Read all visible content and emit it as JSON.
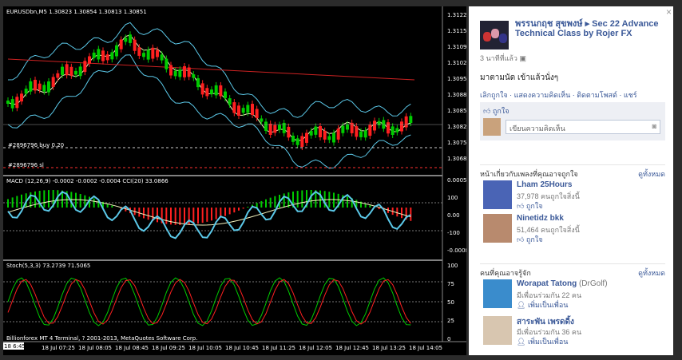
{
  "chart": {
    "symbol_label": "EURUSDbn,M5  1.30823 1.30854 1.30813 1.30851",
    "price_ticks": [
      "1.31225",
      "1.31155",
      "1.31090",
      "1.31020",
      "1.30955",
      "1.30885",
      "1.30851",
      "1.30820",
      "1.30750",
      "1.30685"
    ],
    "order_buy_label": "#2896796 buy 0.20",
    "order_sl_label": "#2896796 sl",
    "macd_label": "MACD (12,26,9) -0.0002 -0.0002 -0.0004  CCI(20) 33.0866",
    "macd_ticks": [
      "0.0005",
      "100",
      "0.00",
      "-100",
      "-0.0008"
    ],
    "stoch_label": "Stoch(5,3,3) 73.2739 71.5065",
    "stoch_ticks": [
      "100",
      "75",
      "50",
      "25",
      "0"
    ],
    "copyright": "Billionforex MT 4 Terminal, ? 2001-2013, MetaQuotes Software Corp.",
    "time_labels": [
      "18 Jul 07:25",
      "18 Jul 08:05",
      "18 Jul 08:45",
      "18 Jul 09:25",
      "18 Jul 10:05",
      "18 Jul 10:45",
      "18 Jul 11:25",
      "18 Jul 12:05",
      "18 Jul 12:45",
      "18 Jul 13:25",
      "18 Jul 14:05"
    ],
    "time_first": "18 6:45 13",
    "colors": {
      "bull": "#00cc00",
      "bear": "#ff2020",
      "band": "#5bc8e8",
      "ma": "#f5f5c0",
      "red_line": "#cc2222"
    }
  },
  "fb": {
    "close": "×",
    "post_title": "พรรนกฤช สุขพงษ์ ▸ Sec 22 Advance Technical Class by Rojer FX",
    "post_time": "3 นาทีที่แล้ว",
    "message": "มาตามนัด เข้าแล้วนั่งๆ",
    "actions": "เลิกถูกใจ · แสดงความคิดเห็น · ติดตามโพสต์ · แชร์",
    "likes": "ถูกใจ",
    "comment_placeholder": "เขียนความคิดเห็น",
    "pages_heading": "หน้าเกี่ยวกับเพลงที่คุณอาจถูกใจ",
    "see_all_1": "ดูทั้งหมด",
    "pages": [
      {
        "name": "Lham 25Hours",
        "sub": "37,978 คนถูกใจสิ่งนี้",
        "act": "ถูกใจ"
      },
      {
        "name": "Ninetidz bkk",
        "sub": "51,464 คนถูกใจสิ่งนี้",
        "act": "ถูกใจ"
      }
    ],
    "people_heading": "คนที่คุณอาจรู้จัก",
    "see_all_2": "ดูทั้งหมด",
    "people": [
      {
        "name": "Worapat Tatong",
        "alias": "(DrGolf)",
        "sub": "มีเพื่อนร่วมกัน 22 คน",
        "act": "เพิ่มเป็นเพื่อน"
      },
      {
        "name": "สาระพัน เพรดดิ้ง",
        "alias": "",
        "sub": "มีเพื่อนร่วมกัน 36 คน",
        "act": "เพิ่มเป็นเพื่อน"
      }
    ]
  }
}
